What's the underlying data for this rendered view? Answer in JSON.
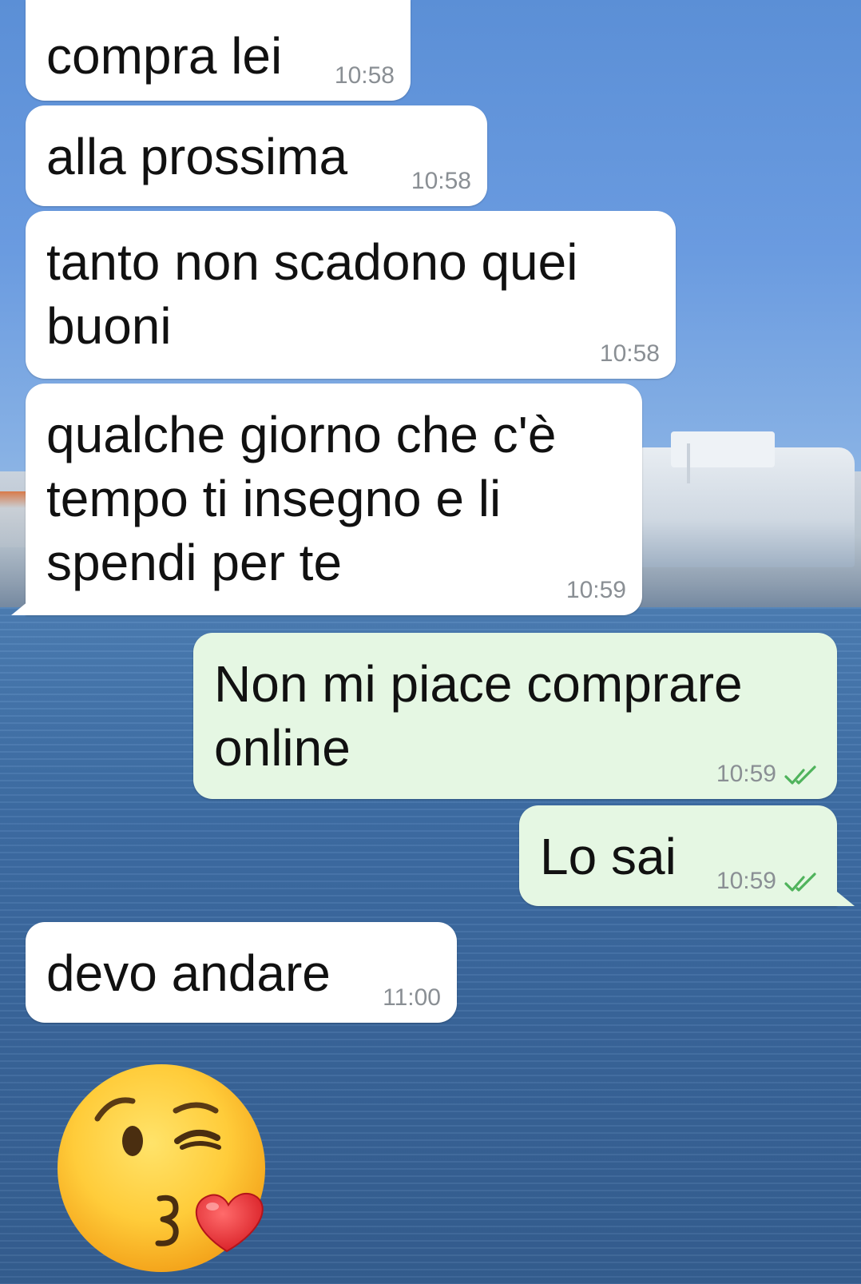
{
  "messages": [
    {
      "direction": "in",
      "text": "compra lei",
      "time": "10:58"
    },
    {
      "direction": "in",
      "text": "alla prossima",
      "time": "10:58"
    },
    {
      "direction": "in",
      "text": "tanto non scadono quei\nbuoni",
      "time": "10:58"
    },
    {
      "direction": "in",
      "text": "qualche giorno che c'è\ntempo ti insegno e li\nspendi per te",
      "time": "10:59"
    },
    {
      "direction": "out",
      "text": "Non mi piace comprare\nonline",
      "time": "10:59",
      "status": "read"
    },
    {
      "direction": "out",
      "text": "Lo sai",
      "time": "10:59",
      "status": "read"
    },
    {
      "direction": "in",
      "text": "devo andare",
      "time": "11:00"
    }
  ],
  "sticker": {
    "icon": "face-blowing-a-kiss-emoji"
  },
  "colors": {
    "incoming_bubble": "#ffffff",
    "outgoing_bubble": "#e5f7e3",
    "read_ticks": "#4fb35c",
    "timestamp": "#8a8f94"
  }
}
